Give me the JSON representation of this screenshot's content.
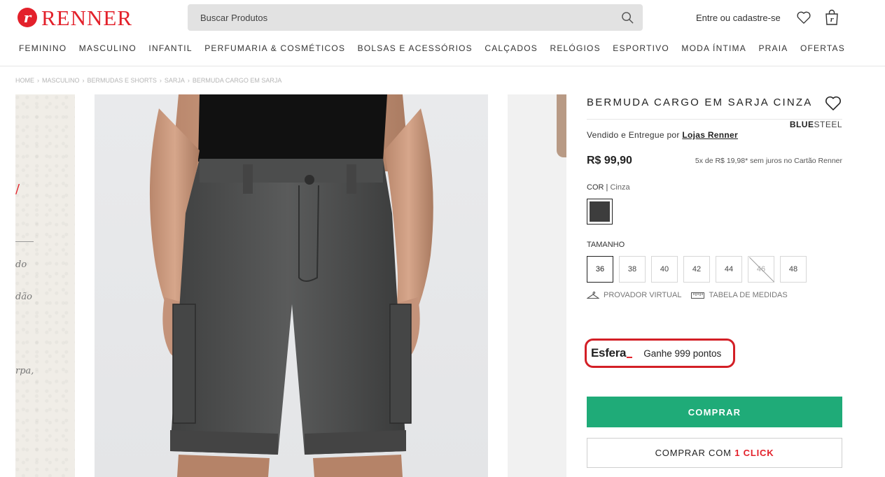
{
  "brand": {
    "logo_mark": "r",
    "logo_text": "RENNER"
  },
  "search": {
    "placeholder": "Buscar Produtos"
  },
  "header": {
    "account_label": "Entre ou cadastre-se"
  },
  "nav": [
    "FEMININO",
    "MASCULINO",
    "INFANTIL",
    "PERFUMARIA & COSMÉTICOS",
    "BOLSAS E ACESSÓRIOS",
    "CALÇADOS",
    "RELÓGIOS",
    "ESPORTIVO",
    "MODA ÍNTIMA",
    "PRAIA",
    "OFERTAS"
  ],
  "breadcrumb": [
    "HOME",
    "MASCULINO",
    "BERMUDAS E SHORTS",
    "SARJA",
    "BERMUDA CARGO EM SARJA"
  ],
  "breadcrumb_sep": "›",
  "gallery": {
    "left_fragments": [
      "do",
      "dão",
      "rpa,"
    ]
  },
  "product": {
    "title": "BERMUDA CARGO EM SARJA CINZA",
    "brand_bold": "BLUE",
    "brand_light": "STEEL",
    "seller_prefix": "Vendido e Entregue por",
    "seller_name": "Lojas Renner",
    "price": "R$ 99,90",
    "installments": "5x de R$ 19,98* sem juros no Cartão Renner",
    "color_label": "COR",
    "color_sep": "|",
    "color_value": "Cinza",
    "color_hex": "#3d3d3d",
    "size_label": "TAMANHO",
    "sizes": [
      {
        "label": "36",
        "selected": true,
        "available": true
      },
      {
        "label": "38",
        "selected": false,
        "available": true
      },
      {
        "label": "40",
        "selected": false,
        "available": true
      },
      {
        "label": "42",
        "selected": false,
        "available": true
      },
      {
        "label": "44",
        "selected": false,
        "available": true
      },
      {
        "label": "46",
        "selected": false,
        "available": false
      },
      {
        "label": "48",
        "selected": false,
        "available": true
      }
    ],
    "virtual_fitting": "PROVADOR VIRTUAL",
    "size_chart": "TABELA DE MEDIDAS"
  },
  "esfera": {
    "logo": "Esfera",
    "text": "Ganhe 999 pontos"
  },
  "actions": {
    "buy": "COMPRAR",
    "oneclick_prefix": "COMPRAR COM",
    "oneclick_highlight": "1 CLICK"
  },
  "colors": {
    "brand_red": "#e3212b",
    "buy_green": "#1fab78",
    "esfera_outline": "#d31f26"
  }
}
